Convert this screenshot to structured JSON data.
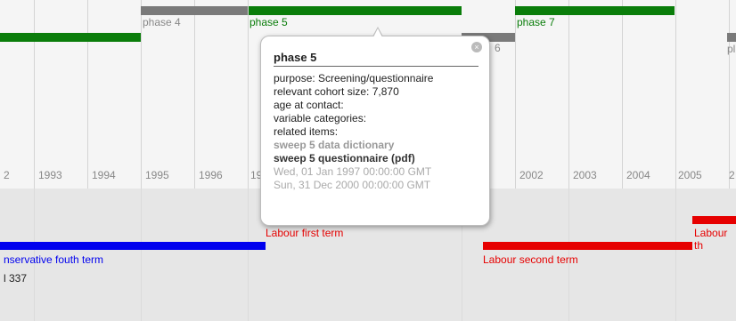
{
  "years": [
    {
      "label": "2"
    },
    {
      "label": "1993"
    },
    {
      "label": "1994"
    },
    {
      "label": "1995"
    },
    {
      "label": "1996"
    },
    {
      "label": "19"
    },
    {
      "label": "2002"
    },
    {
      "label": "2003"
    },
    {
      "label": "2004"
    },
    {
      "label": "2005"
    },
    {
      "label": "2"
    }
  ],
  "phases": [
    {
      "label": "phase 4",
      "color": "#7a7a7a"
    },
    {
      "label": "phase 5",
      "color": "#0a7d0a"
    },
    {
      "label": "6",
      "color": "#7a7a7a"
    },
    {
      "label": "phase 7",
      "color": "#0a7d0a"
    },
    {
      "label": "pl",
      "color": "#7a7a7a"
    }
  ],
  "events": [
    {
      "label": "Labour first term",
      "color": "#e60000"
    },
    {
      "label": "nservative fouth term",
      "color": "#0000ee"
    },
    {
      "label": "Labour second term",
      "color": "#e60000"
    },
    {
      "label": "Labour th",
      "color": "#e60000"
    }
  ],
  "side_text": "l 337",
  "popup": {
    "title": "phase 5",
    "close_glyph": "×",
    "purpose": "purpose: Screening/questionnaire",
    "cohort": "relevant cohort size: 7,870",
    "age": "age at contact:",
    "variables": "variable categories:",
    "related": "related items:",
    "link_dictionary": "sweep 5 data dictionary",
    "link_questionnaire": "sweep 5 questionnaire (pdf)",
    "start": "Wed, 01 Jan 1997 00:00:00 GMT",
    "end": "Sun, 31 Dec 2000 00:00:00 GMT"
  }
}
